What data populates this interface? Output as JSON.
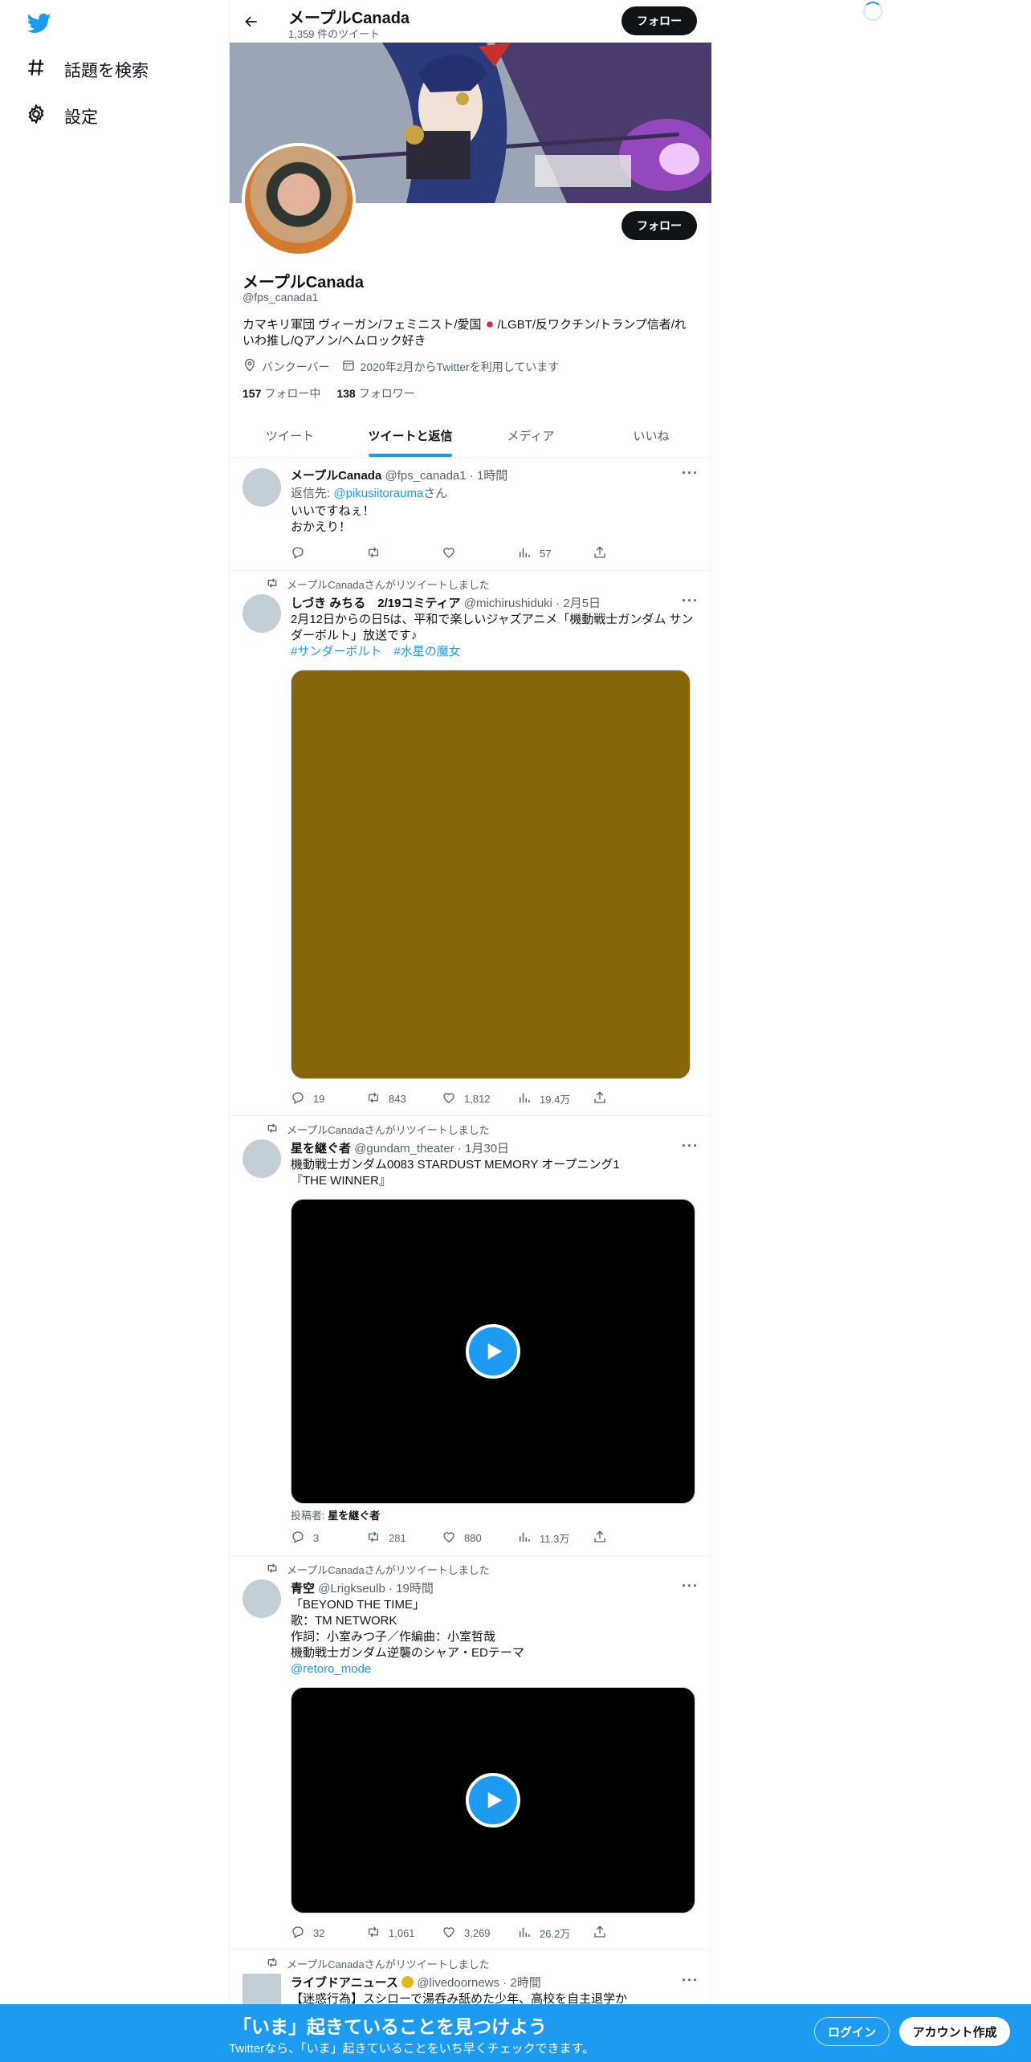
{
  "nav": {
    "items": [
      {
        "label": "話題を検索",
        "icon": "hashtag-icon"
      },
      {
        "label": "設定",
        "icon": "gear-icon"
      }
    ]
  },
  "header": {
    "name": "メープルCanada",
    "tweet_count": "1,359 件のツイート",
    "follow_label": "フォロー"
  },
  "profile": {
    "name": "メープルCanada",
    "handle": "@fps_canada1",
    "bio_a": "カマキリ軍団 ヴィーガン/フェミニスト/愛国",
    "bio_b": "/LGBT/反ワクチン/トランプ信者/れいわ推し/Qアノン/ヘムロック好き",
    "location": "バンクーバー",
    "joined": "2020年2月からTwitterを利用しています",
    "following_count": "157",
    "following_label": "フォロー中",
    "followers_count": "138",
    "followers_label": "フォロワー",
    "follow_label": "フォロー"
  },
  "tabs": [
    "ツイート",
    "ツイートと返信",
    "メディア",
    "いいね"
  ],
  "tweets": [
    {
      "name": "メープルCanada",
      "handle": "@fps_canada1",
      "time": "1時間",
      "reply_prefix": "返信先: ",
      "reply_to": "@pikusiitorauma",
      "reply_suffix": "さん",
      "text": "いいですねぇ！\nおかえり！",
      "reply": "",
      "retweet": "",
      "like": "",
      "views": "57"
    },
    {
      "rt_label": "メープルCanadaさんがリツイートしました",
      "name": "しづき みちる　2/19コミティア",
      "handle": "@michirushiduki",
      "time": "2月5日",
      "text": "2月12日からの日5は、平和で楽しいジャズアニメ「機動戦士ガンダム サンダーボルト」放送です♪",
      "tags": [
        "#サンダーボルト",
        "#水星の魔女"
      ],
      "reply": "19",
      "retweet": "843",
      "like": "1,812",
      "views": "19.4万",
      "media_color": "#87650a"
    },
    {
      "rt_label": "メープルCanadaさんがリツイートしました",
      "name": "星を継ぐ者",
      "handle": "@gundam_theater",
      "time": "1月30日",
      "text": "機動戦士ガンダム0083 STARDUST MEMORY オープニング1\n『THE WINNER』",
      "caption_label": "投稿者: ",
      "caption_name": "星を継ぐ者",
      "reply": "3",
      "retweet": "281",
      "like": "880",
      "views": "11.3万"
    },
    {
      "rt_label": "メープルCanadaさんがリツイートしました",
      "name": "青空",
      "handle": "@Lrigkseulb",
      "time": "19時間",
      "text": "「BEYOND THE TIME」\n歌：TM NETWORK\n作詞：小室みつ子／作編曲：小室哲哉\n機動戦士ガンダム逆襲のシャア・EDテーマ",
      "link": "@retoro_mode",
      "reply": "32",
      "retweet": "1,061",
      "like": "3,269",
      "views": "26.2万"
    },
    {
      "rt_label": "メープルCanadaさんがリツイートしました",
      "name": "ライブドアニュース",
      "handle": "@livedoornews",
      "time": "2時間",
      "text": "【迷惑行為】スシローで湯呑み舐めた少年、高校を自主退学か"
    }
  ],
  "bottom_bar": {
    "title": "「いま」起きていることを見つけよう",
    "subtitle": "Twitterなら、「いま」起きていることをいち早くチェックできます。",
    "login": "ログイン",
    "signup": "アカウント作成"
  },
  "colors": {
    "accent": "#1d9bf0",
    "dark": "#0f1419",
    "muted": "#536471"
  }
}
